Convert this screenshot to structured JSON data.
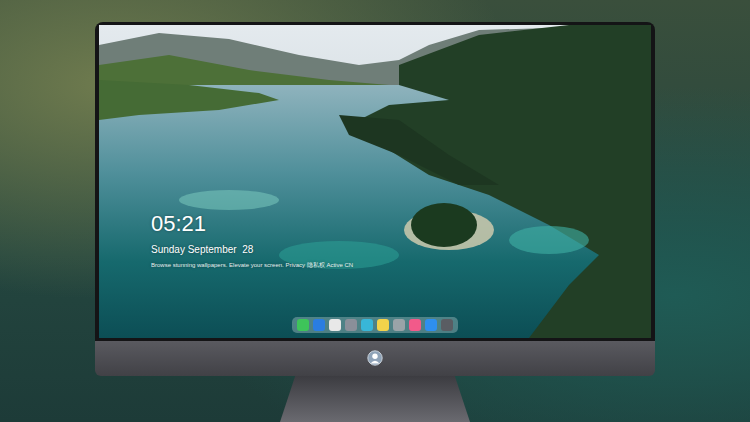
{
  "lock_screen": {
    "time": "05:21",
    "date": "Sunday September  28",
    "caption": "Browse stunning wallpapers. Elevate your screen. Privacy 隐私权  Active CN"
  },
  "dock": {
    "apps": [
      {
        "color": "#3ec45a"
      },
      {
        "color": "#2a7de1"
      },
      {
        "color": "#e8e8e8"
      },
      {
        "color": "#8a8f99"
      },
      {
        "color": "#38b6d8"
      },
      {
        "color": "#f3d34a"
      },
      {
        "color": "#9aa3a8"
      },
      {
        "color": "#f25a8a"
      },
      {
        "color": "#2e8ff0"
      },
      {
        "color": "#5a5d63"
      }
    ]
  }
}
